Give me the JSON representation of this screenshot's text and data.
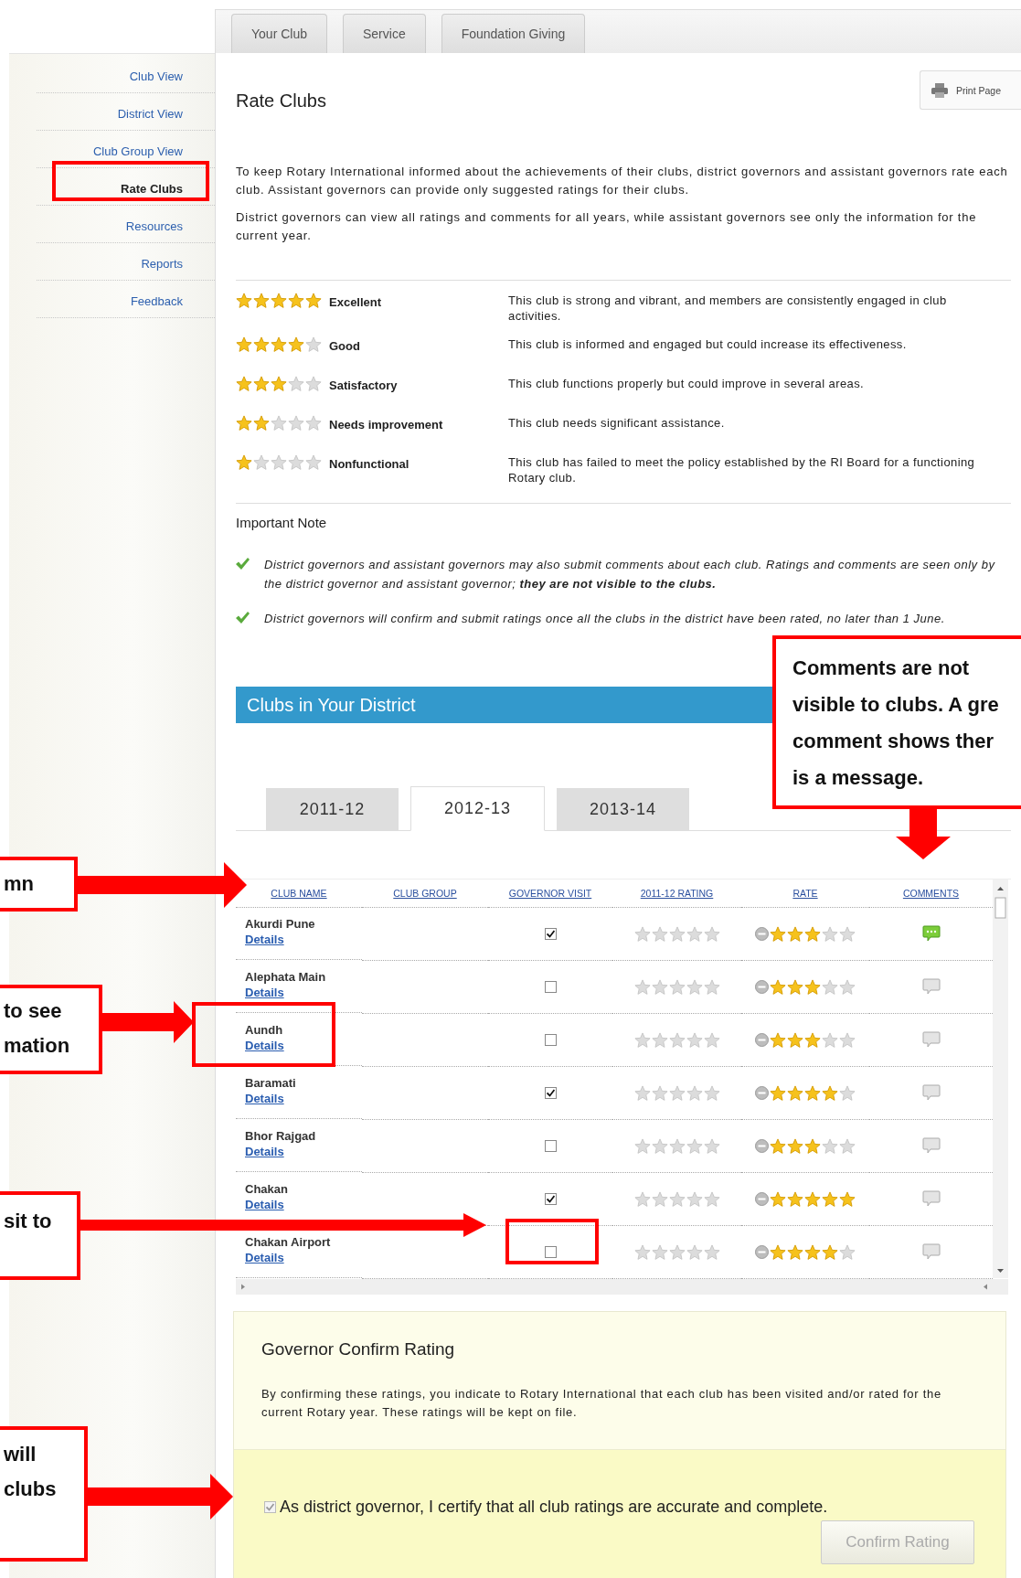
{
  "top_tabs": [
    {
      "label": "Your Club",
      "selected": false
    },
    {
      "label": "Service",
      "selected": false
    },
    {
      "label": "Foundation Giving",
      "selected": false
    }
  ],
  "sidebar": {
    "items": [
      {
        "label": "Club View",
        "selected": false
      },
      {
        "label": "District View",
        "selected": false
      },
      {
        "label": "Club Group View",
        "selected": false
      },
      {
        "label": "Rate Clubs",
        "selected": true
      },
      {
        "label": "Resources",
        "selected": false
      },
      {
        "label": "Reports",
        "selected": false
      },
      {
        "label": "Feedback",
        "selected": false
      }
    ]
  },
  "page": {
    "title": "Rate Clubs",
    "print_button": "Print Page",
    "paragraphs": [
      "To keep Rotary International informed about the achievements of their clubs, district governors and assistant governors rate each club. Assistant governors can provide only suggested ratings for their clubs.",
      "District governors can view all ratings and comments for all years, while assistant governors see only the information for the current year."
    ]
  },
  "rating_legend": [
    {
      "stars": 5,
      "label": "Excellent",
      "description": "This club is strong and vibrant, and members are consistently engaged in club activities."
    },
    {
      "stars": 4,
      "label": "Good",
      "description": "This club is informed and engaged but could increase its effectiveness."
    },
    {
      "stars": 3,
      "label": "Satisfactory",
      "description": "This club functions properly but could improve in several areas."
    },
    {
      "stars": 2,
      "label": "Needs improvement",
      "description": "This club needs significant assistance."
    },
    {
      "stars": 1,
      "label": "Nonfunctional",
      "description": "This club has failed to meet the policy established by the RI Board for a functioning Rotary club."
    }
  ],
  "important_note": {
    "title": "Important Note",
    "items": [
      "District governors and assistant governors may also submit comments about each club. Ratings and comments are seen only by the district governor and assistant governor; **they are not visible to the clubs.**",
      "District governors will confirm and submit ratings once all the clubs in the district have been rated, no later than 1 June."
    ]
  },
  "clubs": {
    "title": "Clubs in Your District",
    "year_tabs": [
      {
        "label": "2011-12",
        "selected": false
      },
      {
        "label": "2012-13",
        "selected": true
      },
      {
        "label": "2013-14",
        "selected": false
      }
    ],
    "columns": [
      "CLUB NAME",
      "CLUB GROUP",
      "GOVERNOR VISIT",
      "2011-12 RATING",
      "RATE",
      "COMMENTS"
    ],
    "rows": [
      {
        "name": "Akurdi Pune",
        "link": "Details",
        "governor_visit": true,
        "previous_rating": {
          "stars": 0
        },
        "rate": {
          "stars": 3
        },
        "has_comment": true
      },
      {
        "name": "Alephata Main",
        "link": "Details",
        "governor_visit": false,
        "previous_rating": {
          "stars": 0
        },
        "rate": {
          "stars": 3
        },
        "has_comment": false
      },
      {
        "name": "Aundh",
        "link": "Details",
        "governor_visit": false,
        "previous_rating": {
          "stars": 0
        },
        "rate": {
          "stars": 3
        },
        "has_comment": false
      },
      {
        "name": "Baramati",
        "link": "Details",
        "governor_visit": true,
        "previous_rating": {
          "stars": 0
        },
        "rate": {
          "stars": 4
        },
        "has_comment": false
      },
      {
        "name": "Bhor Rajgad",
        "link": "Details",
        "governor_visit": false,
        "previous_rating": {
          "stars": 0
        },
        "rate": {
          "stars": 3
        },
        "has_comment": false
      },
      {
        "name": "Chakan",
        "link": "Details",
        "governor_visit": true,
        "previous_rating": {
          "stars": 0
        },
        "rate": {
          "stars": 5
        },
        "has_comment": false
      },
      {
        "name": "Chakan Airport",
        "link": "Details",
        "governor_visit": false,
        "previous_rating": {
          "stars": 0
        },
        "rate": {
          "stars": 4
        },
        "has_comment": false
      }
    ]
  },
  "confirm": {
    "title": "Governor Confirm Rating",
    "text": "By confirming these ratings, you indicate to Rotary International that each club has been visited and/or rated for the current Rotary year. These ratings will be kept on file.",
    "certify": {
      "label": "As district governor, I certify that all club ratings are accurate and complete.",
      "checked": true,
      "disabled": true
    },
    "button": {
      "label": "Confirm Rating",
      "disabled": true
    }
  },
  "annotations": [
    {
      "lines": [
        "Comments are not",
        "visible to clubs. A gre",
        "comment shows ther",
        "is a message."
      ]
    },
    {
      "lines": [
        "mn"
      ]
    },
    {
      "lines": [
        "to see",
        "mation"
      ]
    },
    {
      "lines": [
        "sit to"
      ]
    },
    {
      "lines": [
        "will",
        "clubs"
      ]
    }
  ]
}
